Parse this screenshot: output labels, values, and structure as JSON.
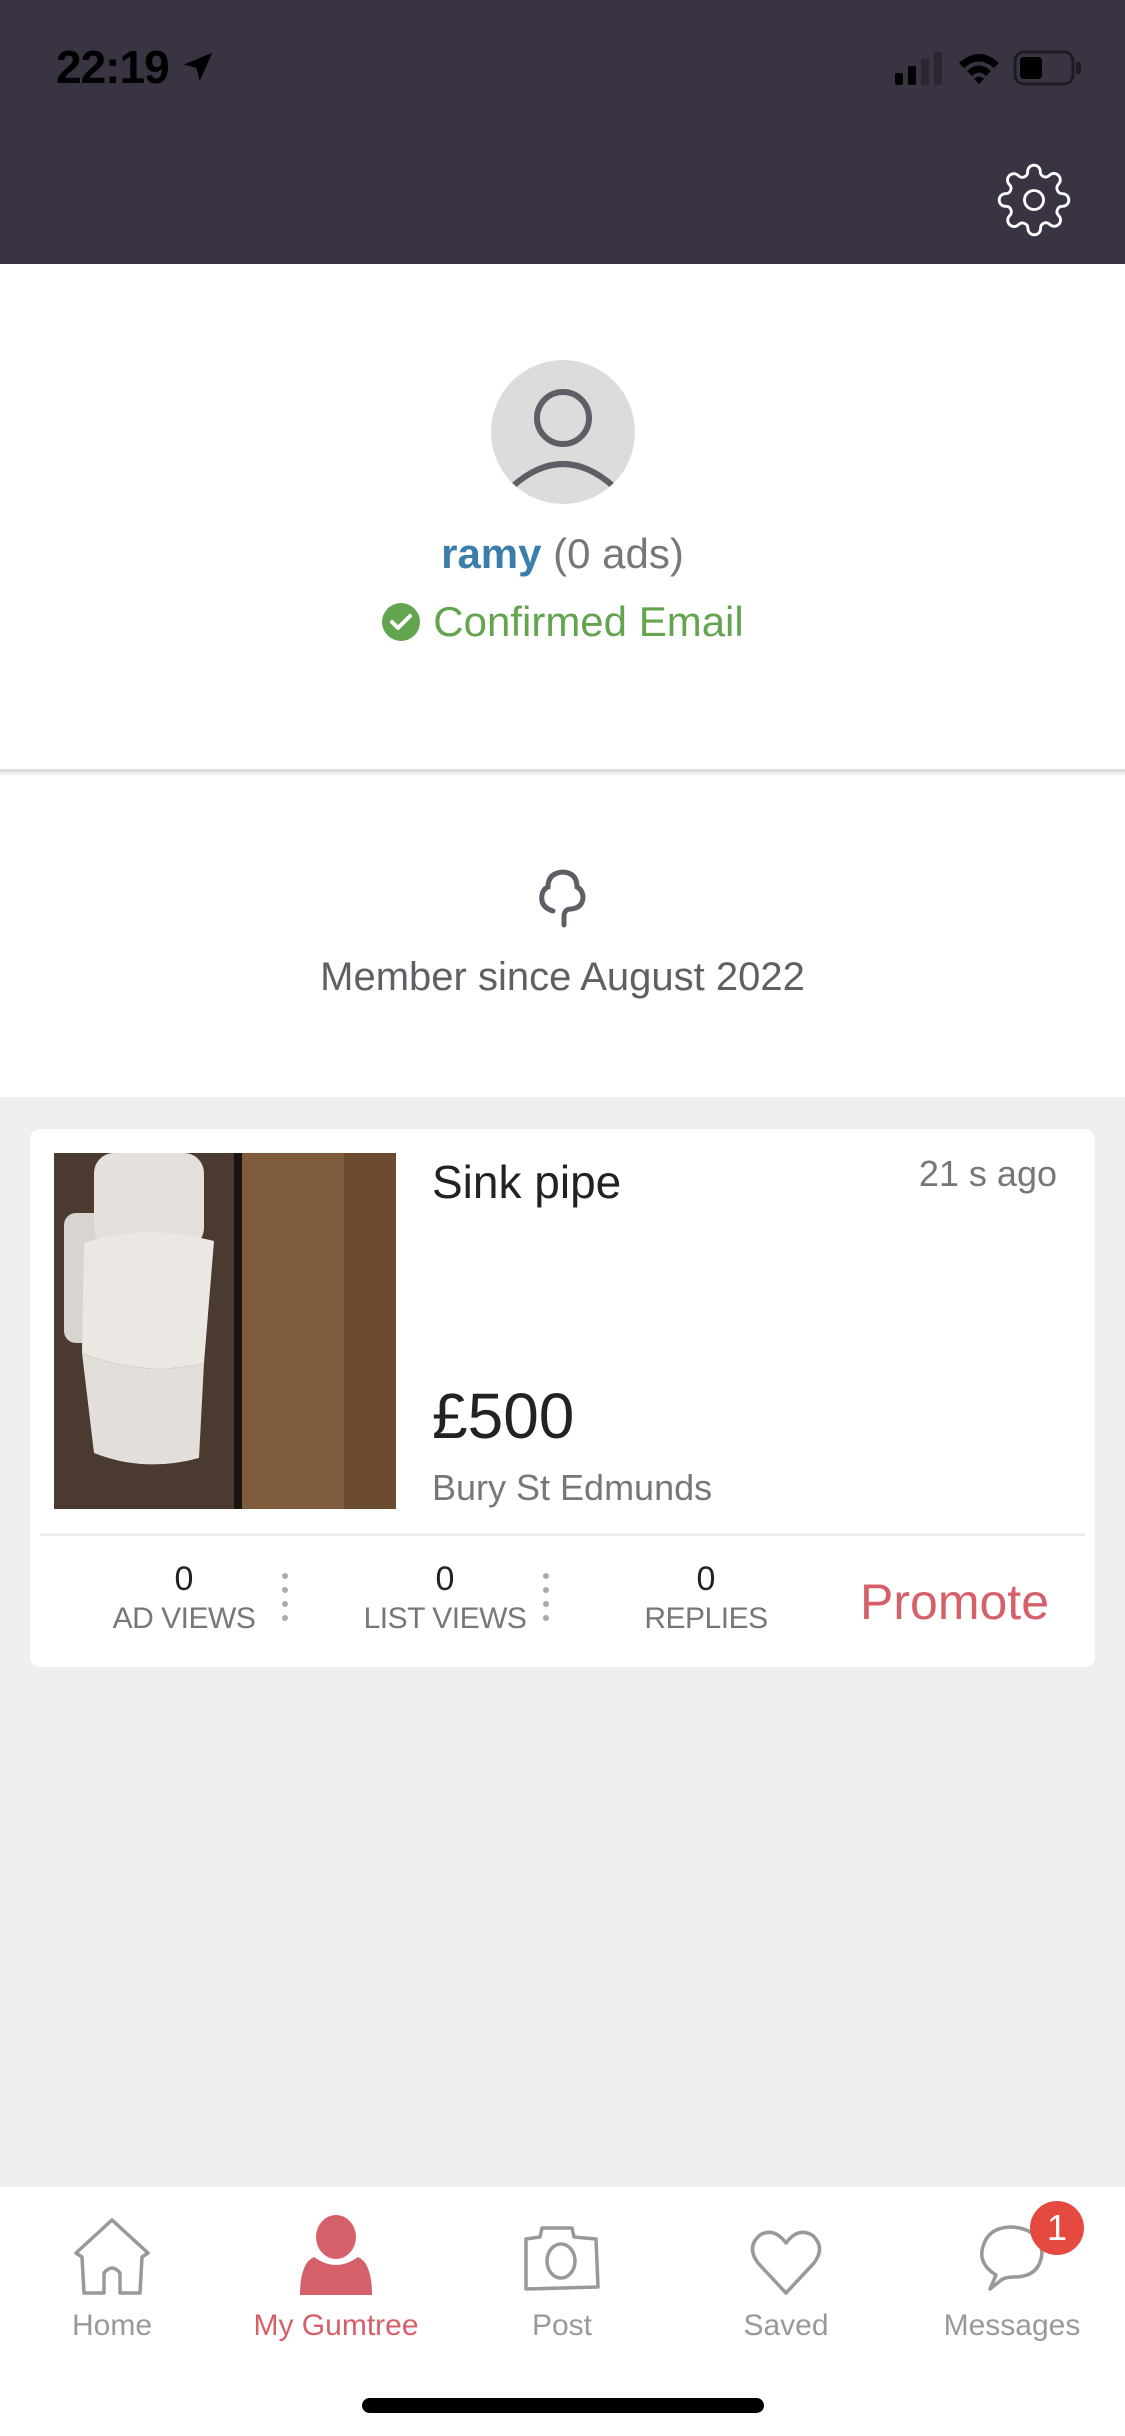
{
  "status_bar": {
    "time": "22:19",
    "location_icon": "location-arrow-icon",
    "signal_icon": "cellular-signal-icon",
    "wifi_icon": "wifi-icon",
    "battery_icon": "battery-icon"
  },
  "header": {
    "settings_icon": "gear-icon"
  },
  "profile": {
    "avatar_icon": "user-avatar-icon",
    "username": "ramy",
    "ads_count": "(0 ads)",
    "confirmed_label": "Confirmed Email",
    "confirmed_icon": "check-circle-icon"
  },
  "member": {
    "icon": "gumtree-tree-icon",
    "text": "Member since August 2022"
  },
  "ads": [
    {
      "title": "Sink pipe",
      "posted": "21 s ago",
      "price": "£500",
      "location": "Bury St Edmunds",
      "stats": [
        {
          "value": "0",
          "label": "AD VIEWS"
        },
        {
          "value": "0",
          "label": "LIST VIEWS"
        },
        {
          "value": "0",
          "label": "REPLIES"
        }
      ],
      "promote_label": "Promote"
    }
  ],
  "tabbar": {
    "items": [
      {
        "label": "Home",
        "icon": "home-icon",
        "active": false
      },
      {
        "label": "My Gumtree",
        "icon": "user-icon",
        "active": true
      },
      {
        "label": "Post",
        "icon": "camera-icon",
        "active": false
      },
      {
        "label": "Saved",
        "icon": "heart-icon",
        "active": false
      },
      {
        "label": "Messages",
        "icon": "chat-bubble-icon",
        "active": false,
        "badge": "1"
      }
    ]
  },
  "colors": {
    "header_bg": "#3a3342",
    "accent": "#d6606a",
    "username": "#3c7eab",
    "confirmed": "#63a44f",
    "badge": "#e5493f"
  }
}
